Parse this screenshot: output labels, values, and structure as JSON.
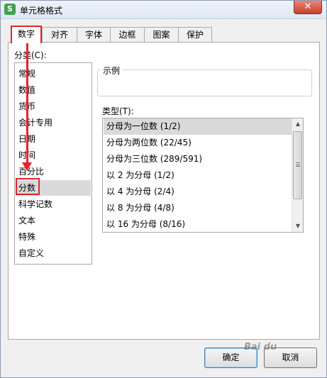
{
  "window": {
    "title": "单元格格式",
    "close_symbol": "✕",
    "app_icon_letter": "S"
  },
  "tabs": [
    {
      "label": "数字",
      "active": true
    },
    {
      "label": "对齐",
      "active": false
    },
    {
      "label": "字体",
      "active": false
    },
    {
      "label": "边框",
      "active": false
    },
    {
      "label": "图案",
      "active": false
    },
    {
      "label": "保护",
      "active": false
    }
  ],
  "category": {
    "label": "分类(C):",
    "items": [
      "常规",
      "数值",
      "货币",
      "会计专用",
      "日期",
      "时间",
      "百分比",
      "分数",
      "科学记数",
      "文本",
      "特殊",
      "自定义"
    ],
    "selected_index": 7
  },
  "sample": {
    "label": "示例",
    "value": ""
  },
  "type": {
    "label": "类型(T):",
    "items": [
      "分母为一位数 (1/2)",
      "分母为两位数 (22/45)",
      "分母为三位数 (289/591)",
      "以 2 为分母 (1/2)",
      "以 4 为分母 (2/4)",
      "以 8 为分母 (4/8)",
      "以 16 为分母 (8/16)"
    ],
    "selected_index": 0
  },
  "buttons": {
    "ok": "确定",
    "cancel": "取消"
  },
  "watermark": "Bai du",
  "colors": {
    "annotation_red": "#e3242b",
    "selection": "#d9d9d9",
    "app_icon_green": "#3fa44a"
  }
}
